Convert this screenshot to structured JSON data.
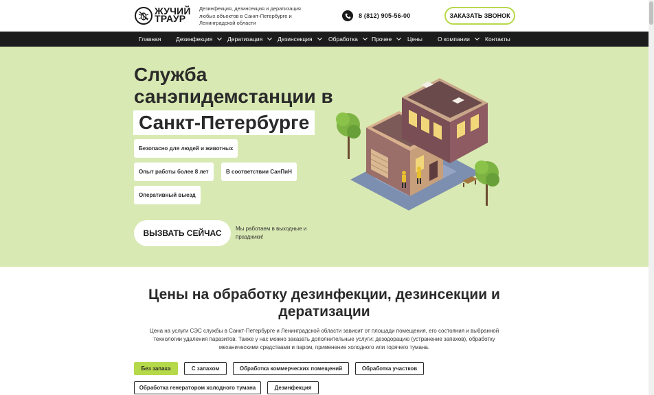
{
  "header": {
    "logo_text": "ЖУЧИЙ\nТРАУР",
    "tagline": "Дезинфекция, дезинсекция и дератизация любых объектов в Санкт-Петербурге и Ленинградской области",
    "phone": "8 (812) 905-56-00",
    "callback_label": "ЗАКАЗАТЬ ЗВОНОК"
  },
  "nav": {
    "items": [
      {
        "label": "Главная",
        "dropdown": false
      },
      {
        "label": "Дезинфекция",
        "dropdown": true
      },
      {
        "label": "Дератизация",
        "dropdown": true
      },
      {
        "label": "Дезинсекция",
        "dropdown": true
      },
      {
        "label": "Обработка",
        "dropdown": true
      },
      {
        "label": "Прочее",
        "dropdown": true
      },
      {
        "label": "Цены",
        "dropdown": false
      },
      {
        "label": "О компании",
        "dropdown": true
      },
      {
        "label": "Контакты",
        "dropdown": false
      }
    ]
  },
  "hero": {
    "title_line1": "Служба",
    "title_line2": "санэпидемстанции в",
    "title_highlight": "Санкт-Петербурге",
    "features": [
      "Безопасно для людей и животных",
      "Опыт работы более 8 лет",
      "В соответствии СанПиН",
      "Оперативный выезд"
    ],
    "cta_label": "ВЫЗВАТЬ СЕЙЧАС",
    "cta_note": "Мы работаем в выходные и праздники!"
  },
  "prices": {
    "title": "Цены на обработку дезинфекции, дезинсекции и дератизации",
    "description": "Цена на услуги СЭС службы в Санкт-Петербурге и Ленинградской области зависит от площади помещения, его состояния и выбранной технологии удаления паразитов. Также у нас можно заказать дополнительные услуги: дезодорацию (устранение запахов), обработку механическими средствами и паром, применение холодного или горячего тумана.",
    "tabs": [
      {
        "label": "Без запаха",
        "active": true
      },
      {
        "label": "С запахом",
        "active": false
      },
      {
        "label": "Обработка коммерческих помещений",
        "active": false
      },
      {
        "label": "Обработка участков",
        "active": false
      },
      {
        "label": "Обработка генератором холодного тумана",
        "active": false
      },
      {
        "label": "Дезинфекция",
        "active": false
      }
    ]
  },
  "colors": {
    "accent": "#b6d94a",
    "hero_bg": "#d9e9b3",
    "nav_bg": "#1c1c1c"
  },
  "icons": [
    "logo-beetle-icon",
    "phone-icon",
    "chevron-down-icon"
  ]
}
